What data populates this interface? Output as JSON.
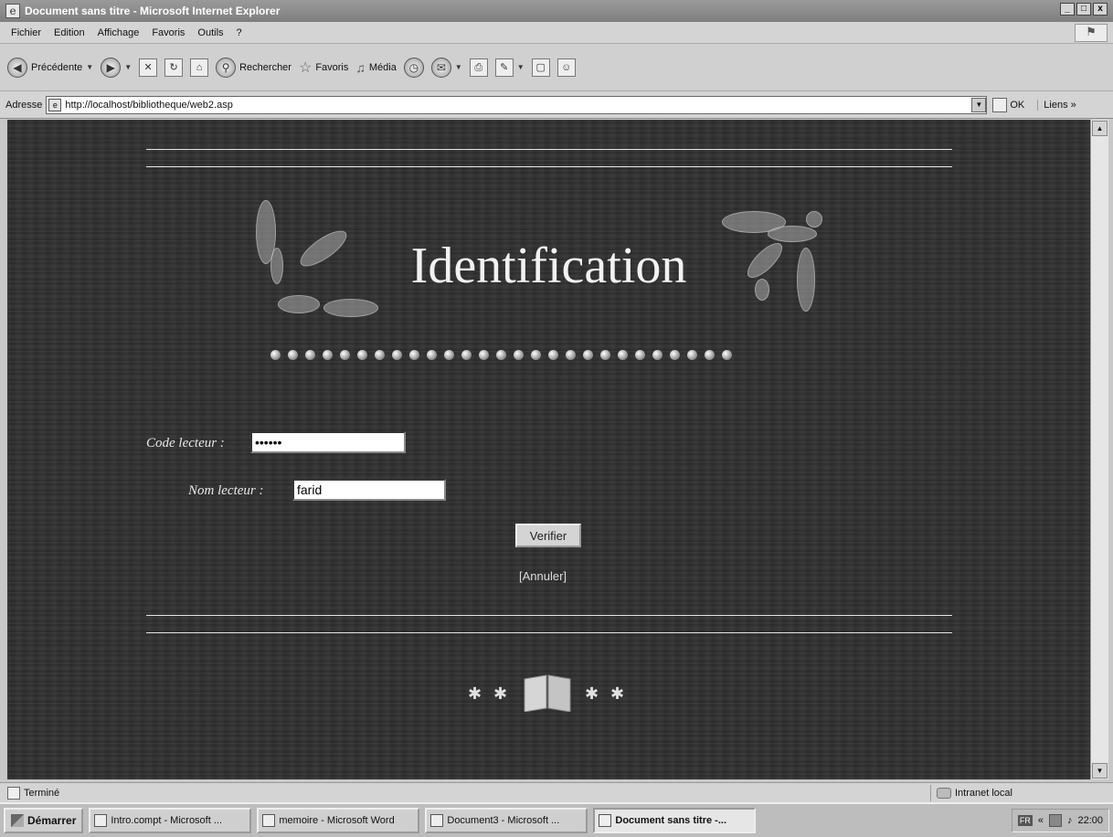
{
  "window": {
    "title": "Document sans titre - Microsoft Internet Explorer",
    "controls": [
      "_",
      "□",
      "x"
    ]
  },
  "menu": [
    "Fichier",
    "Edition",
    "Affichage",
    "Favoris",
    "Outils",
    "?"
  ],
  "toolbar": {
    "back": "Précédente",
    "search": "Rechercher",
    "favorites": "Favoris",
    "media": "Média"
  },
  "address": {
    "label": "Adresse",
    "url": "http://localhost/bibliotheque/web2.asp",
    "go": "OK",
    "links": "Liens",
    "links_chevron": "»"
  },
  "page": {
    "heading": "Identification",
    "code_label": "Code lecteur :",
    "code_value": "••••••",
    "name_label": "Nom lecteur :",
    "name_value": "farid",
    "verify_button": "Verifier",
    "cancel_link": "[Annuler]"
  },
  "status": {
    "text": "Terminé",
    "zone": "Intranet local"
  },
  "taskbar": {
    "start": "Démarrer",
    "items": [
      {
        "label": "Intro.compt - Microsoft ...",
        "active": false
      },
      {
        "label": "memoire - Microsoft Word",
        "active": false
      },
      {
        "label": "Document3 - Microsoft ...",
        "active": false
      },
      {
        "label": "Document sans titre -...",
        "active": true
      }
    ],
    "lang": "FR",
    "tray_chevron": "«",
    "clock": "22:00"
  },
  "colors": {
    "page_background": "#2f2f2f",
    "page_text": "#f2f2f2",
    "chrome": "#d4d4d4"
  }
}
